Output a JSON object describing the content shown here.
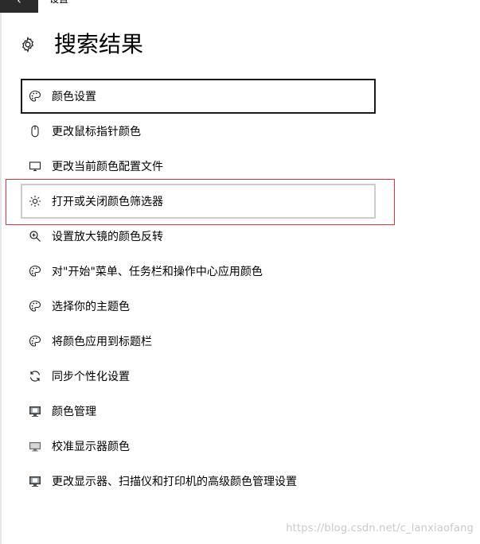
{
  "window": {
    "title": "设置",
    "back_glyph": "‹"
  },
  "header": {
    "title": "搜索结果",
    "icon": "gear-icon"
  },
  "results": [
    {
      "label": "颜色设置",
      "icon": "palette-icon",
      "state": "focused"
    },
    {
      "label": "更改鼠标指针颜色",
      "icon": "mouse-icon"
    },
    {
      "label": "更改当前颜色配置文件",
      "icon": "monitor-icon"
    },
    {
      "label": "打开或关闭颜色筛选器",
      "icon": "brightness-icon",
      "state": "hovered"
    },
    {
      "label": "设置放大镜的颜色反转",
      "icon": "magnifier-icon"
    },
    {
      "label": "对\"开始\"菜单、任务栏和操作中心应用颜色",
      "icon": "palette-icon"
    },
    {
      "label": "选择你的主题色",
      "icon": "palette-icon"
    },
    {
      "label": "将颜色应用到标题栏",
      "icon": "palette-icon"
    },
    {
      "label": "同步个性化设置",
      "icon": "sync-icon"
    },
    {
      "label": "颜色管理",
      "icon": "color-management-icon"
    },
    {
      "label": "校准显示器颜色",
      "icon": "calibrate-display-icon"
    },
    {
      "label": "更改显示器、扫描仪和打印机的高级颜色管理设置",
      "icon": "color-management-icon"
    }
  ],
  "watermark": "https://blog.csdn.net/c_lanxiaofang",
  "colors": {
    "focus_border": "#1a1a1a",
    "hover_border": "#cccccc",
    "annotation": "#e0323a"
  }
}
